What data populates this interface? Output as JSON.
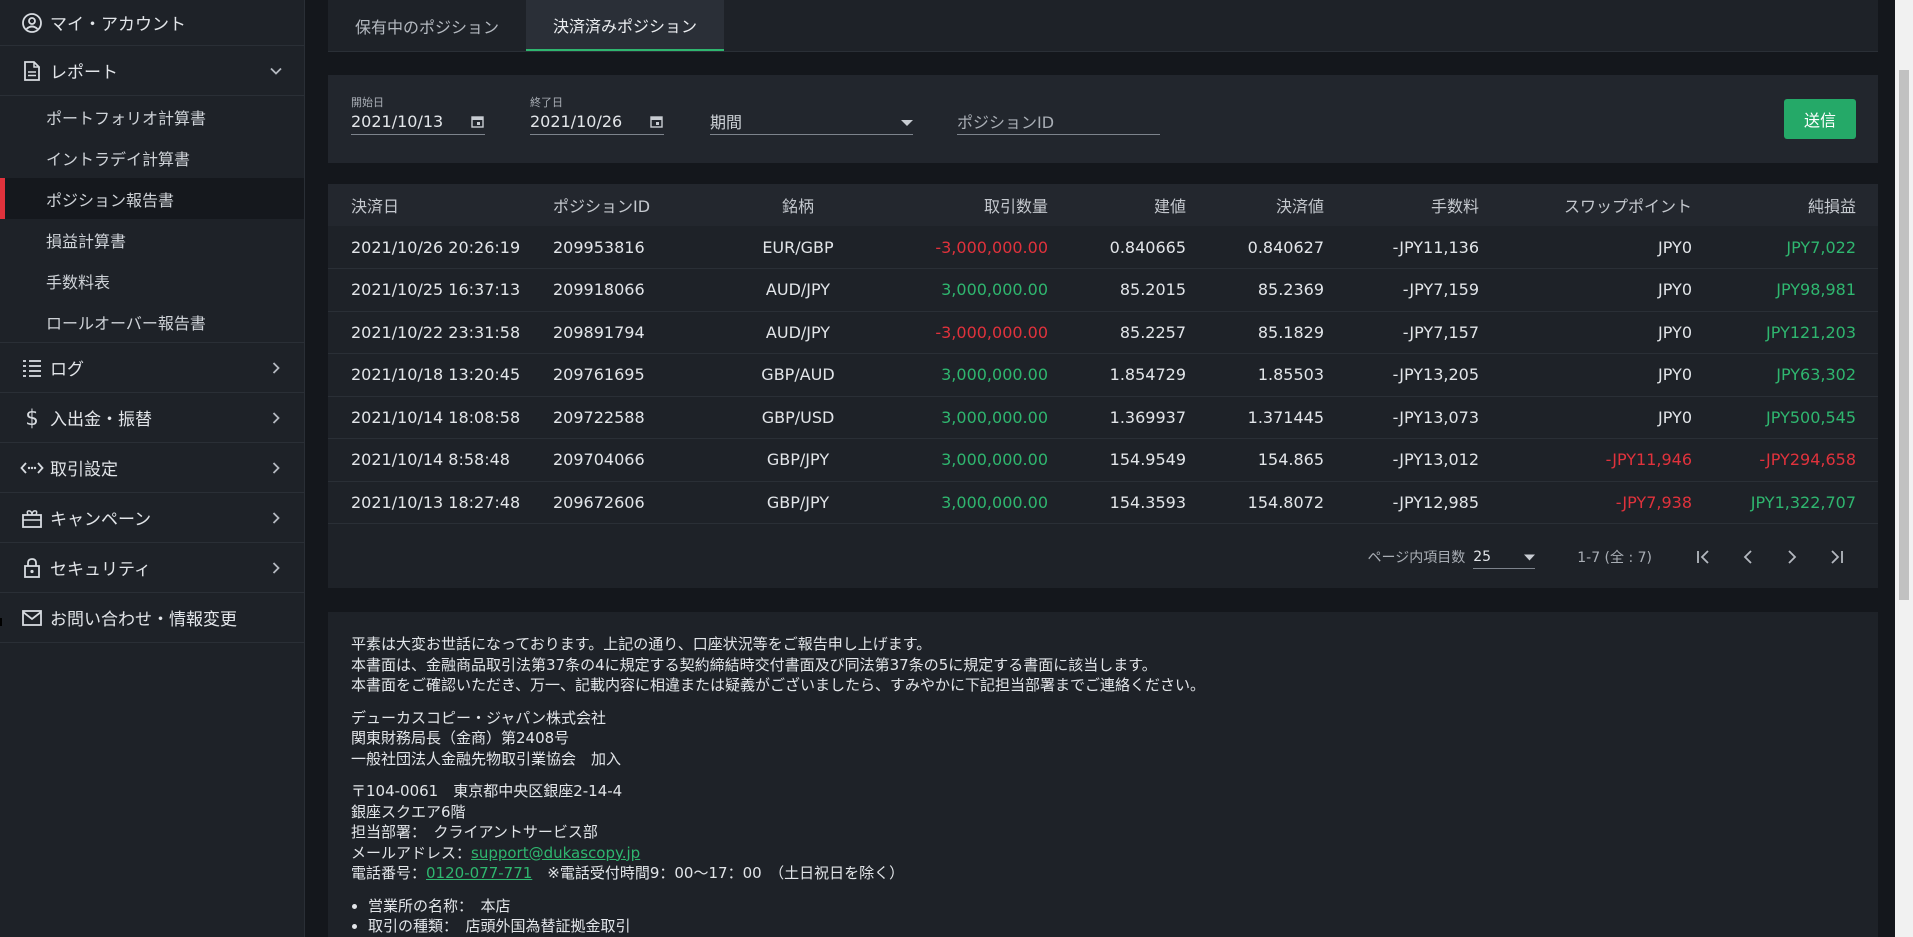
{
  "sidebar": {
    "top_items": [
      {
        "label": "マイ・アカウント",
        "icon": "account-icon"
      },
      {
        "label": "レポート",
        "icon": "document-icon",
        "expanded": true
      }
    ],
    "report_sub": [
      {
        "label": "ポートフォリオ計算書"
      },
      {
        "label": "イントラデイ計算書"
      },
      {
        "label": "ポジション報告書",
        "active": true
      },
      {
        "label": "損益計算書"
      },
      {
        "label": "手数料表"
      },
      {
        "label": "ロールオーバー報告書"
      }
    ],
    "items": [
      {
        "label": "ログ",
        "icon": "log-list-icon"
      },
      {
        "label": "入出金・振替",
        "icon": "dollar-icon"
      },
      {
        "label": "取引設定",
        "icon": "code-icon"
      },
      {
        "label": "キャンペーン",
        "icon": "gift-icon"
      },
      {
        "label": "セキュリティ",
        "icon": "lock-icon"
      },
      {
        "label": "お問い合わせ・情報変更",
        "icon": "mail-icon"
      }
    ]
  },
  "tabs": [
    {
      "label": "保有中のポジション",
      "active": false
    },
    {
      "label": "決済済みポジション",
      "active": true
    }
  ],
  "filter": {
    "start_label": "開始日",
    "start_value": "2021/10/13",
    "end_label": "終了日",
    "end_value": "2021/10/26",
    "period_value": "期間",
    "position_placeholder": "ポジションID",
    "send_label": "送信"
  },
  "table": {
    "headers": [
      "決済日",
      "ポジションID",
      "銘柄",
      "取引数量",
      "建値",
      "決済値",
      "手数料",
      "スワップポイント",
      "純損益"
    ],
    "rows": [
      [
        "2021/10/26 20:26:19",
        "209953816",
        "EUR/GBP",
        "-3,000,000.00",
        "0.840665",
        "0.840627",
        "-JPY11,136",
        "JPY0",
        "JPY7,022"
      ],
      [
        "2021/10/25 16:37:13",
        "209918066",
        "AUD/JPY",
        "3,000,000.00",
        "85.2015",
        "85.2369",
        "-JPY7,159",
        "JPY0",
        "JPY98,981"
      ],
      [
        "2021/10/22 23:31:58",
        "209891794",
        "AUD/JPY",
        "-3,000,000.00",
        "85.2257",
        "85.1829",
        "-JPY7,157",
        "JPY0",
        "JPY121,203"
      ],
      [
        "2021/10/18 13:20:45",
        "209761695",
        "GBP/AUD",
        "3,000,000.00",
        "1.854729",
        "1.85503",
        "-JPY13,205",
        "JPY0",
        "JPY63,302"
      ],
      [
        "2021/10/14 18:08:58",
        "209722588",
        "GBP/USD",
        "3,000,000.00",
        "1.369937",
        "1.371445",
        "-JPY13,073",
        "JPY0",
        "JPY500,545"
      ],
      [
        "2021/10/14 8:58:48",
        "209704066",
        "GBP/JPY",
        "3,000,000.00",
        "154.9549",
        "154.865",
        "-JPY13,012",
        "-JPY11,946",
        "-JPY294,658"
      ],
      [
        "2021/10/13 18:27:48",
        "209672606",
        "GBP/JPY",
        "3,000,000.00",
        "154.3593",
        "154.8072",
        "-JPY12,985",
        "-JPY7,938",
        "JPY1,322,707"
      ]
    ]
  },
  "pager": {
    "per_page_label": "ページ内項目数",
    "per_page_value": "25",
    "range": "1-7 (全 : 7)"
  },
  "notice": {
    "para1": [
      "平素は大変お世話になっております。上記の通り、口座状況等をご報告申し上げます。",
      "本書面は、金融商品取引法第37条の4に規定する契約締結時交付書面及び同法第37条の5に規定する書面に該当します。",
      "本書面をご確認いただき、万一、記載内容に相違または疑義がございましたら、すみやかに下記担当部署までご連絡ください。"
    ],
    "para2": [
      "デューカスコピー・ジャパン株式会社",
      "関東財務局長（金商）第2408号",
      "一般社団法人金融先物取引業協会　加入"
    ],
    "address1": "〒104-0061　東京都中央区銀座2-14-4",
    "address2": "銀座スクエア6階",
    "dept": "担当部署：　クライアントサービス部",
    "mail_label": "メールアドレス：",
    "mail": "support@dukascopy.jp",
    "phone_label": "電話番号：",
    "phone": "0120-077-771",
    "phone_note": "　※電話受付時間9：00～17：00　（土日祝日を除く）",
    "bullets": [
      "営業所の名称：　本店",
      "取引の種類：　店頭外国為替証拠金取引"
    ]
  },
  "colors": {
    "accent_green": "#2fb66f",
    "negative_red": "#e0323c",
    "active_marker": "#e0323c",
    "send_button": "#25a968"
  }
}
